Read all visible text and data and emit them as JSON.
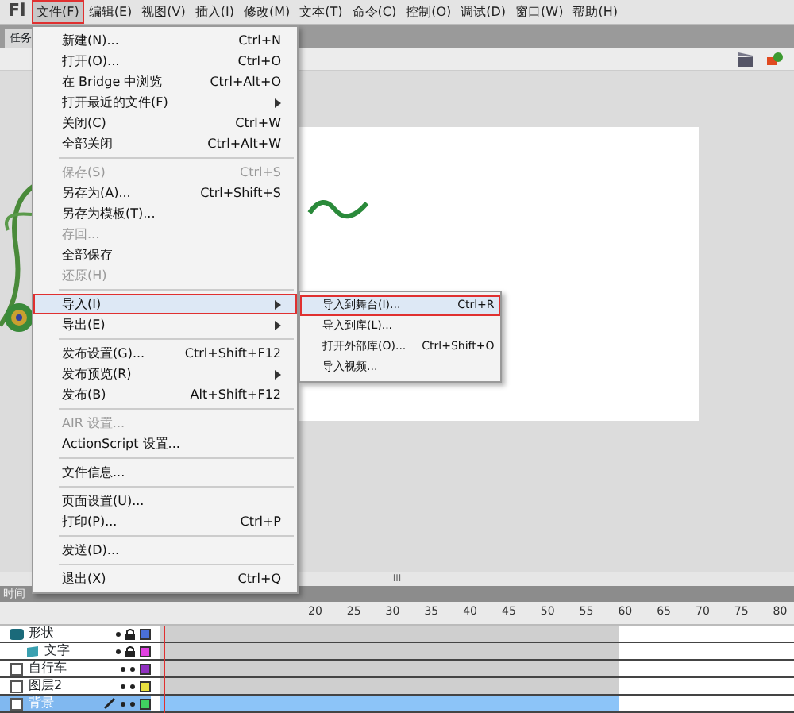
{
  "app": {
    "logo": "Fl"
  },
  "menu_bar": [
    {
      "label": "文件(F)",
      "selected": true,
      "highlighted": true
    },
    {
      "label": "编辑(E)",
      "selected": false,
      "highlighted": false
    },
    {
      "label": "视图(V)",
      "selected": false,
      "highlighted": false
    },
    {
      "label": "插入(I)",
      "selected": false,
      "highlighted": false
    },
    {
      "label": "修改(M)",
      "selected": false,
      "highlighted": false
    },
    {
      "label": "文本(T)",
      "selected": false,
      "highlighted": false
    },
    {
      "label": "命令(C)",
      "selected": false,
      "highlighted": false
    },
    {
      "label": "控制(O)",
      "selected": false,
      "highlighted": false
    },
    {
      "label": "调试(D)",
      "selected": false,
      "highlighted": false
    },
    {
      "label": "窗口(W)",
      "selected": false,
      "highlighted": false
    },
    {
      "label": "帮助(H)",
      "selected": false,
      "highlighted": false
    }
  ],
  "document_tab": {
    "label": "任务"
  },
  "file_menu": [
    {
      "kind": "item",
      "label": "新建(N)...",
      "shortcut": "Ctrl+N",
      "disabled": false,
      "submenu": false,
      "selected": false,
      "highlighted": false
    },
    {
      "kind": "item",
      "label": "打开(O)...",
      "shortcut": "Ctrl+O",
      "disabled": false,
      "submenu": false,
      "selected": false,
      "highlighted": false
    },
    {
      "kind": "item",
      "label": "在 Bridge 中浏览",
      "shortcut": "Ctrl+Alt+O",
      "disabled": false,
      "submenu": false,
      "selected": false,
      "highlighted": false
    },
    {
      "kind": "item",
      "label": "打开最近的文件(F)",
      "disabled": false,
      "submenu": true,
      "selected": false,
      "highlighted": false
    },
    {
      "kind": "item",
      "label": "关闭(C)",
      "shortcut": "Ctrl+W",
      "disabled": false,
      "submenu": false,
      "selected": false,
      "highlighted": false
    },
    {
      "kind": "item",
      "label": "全部关闭",
      "shortcut": "Ctrl+Alt+W",
      "disabled": false,
      "submenu": false,
      "selected": false,
      "highlighted": false
    },
    {
      "kind": "separator"
    },
    {
      "kind": "item",
      "label": "保存(S)",
      "shortcut": "Ctrl+S",
      "disabled": true,
      "submenu": false,
      "selected": false,
      "highlighted": false
    },
    {
      "kind": "item",
      "label": "另存为(A)...",
      "shortcut": "Ctrl+Shift+S",
      "disabled": false,
      "submenu": false,
      "selected": false,
      "highlighted": false
    },
    {
      "kind": "item",
      "label": "另存为模板(T)...",
      "disabled": false,
      "submenu": false,
      "selected": false,
      "highlighted": false
    },
    {
      "kind": "item",
      "label": "存回...",
      "disabled": true,
      "submenu": false,
      "selected": false,
      "highlighted": false
    },
    {
      "kind": "item",
      "label": "全部保存",
      "disabled": false,
      "submenu": false,
      "selected": false,
      "highlighted": false
    },
    {
      "kind": "item",
      "label": "还原(H)",
      "disabled": true,
      "submenu": false,
      "selected": false,
      "highlighted": false
    },
    {
      "kind": "separator"
    },
    {
      "kind": "item",
      "label": "导入(I)",
      "disabled": false,
      "submenu": true,
      "selected": true,
      "highlighted": true
    },
    {
      "kind": "item",
      "label": "导出(E)",
      "disabled": false,
      "submenu": true,
      "selected": false,
      "highlighted": false
    },
    {
      "kind": "separator"
    },
    {
      "kind": "item",
      "label": "发布设置(G)...",
      "shortcut": "Ctrl+Shift+F12",
      "disabled": false,
      "submenu": false,
      "selected": false,
      "highlighted": false
    },
    {
      "kind": "item",
      "label": "发布预览(R)",
      "disabled": false,
      "submenu": true,
      "selected": false,
      "highlighted": false
    },
    {
      "kind": "item",
      "label": "发布(B)",
      "shortcut": "Alt+Shift+F12",
      "disabled": false,
      "submenu": false,
      "selected": false,
      "highlighted": false
    },
    {
      "kind": "separator"
    },
    {
      "kind": "item",
      "label": "AIR 设置...",
      "disabled": true,
      "submenu": false,
      "selected": false,
      "highlighted": false
    },
    {
      "kind": "item",
      "label": "ActionScript 设置...",
      "disabled": false,
      "submenu": false,
      "selected": false,
      "highlighted": false
    },
    {
      "kind": "separator"
    },
    {
      "kind": "item",
      "label": "文件信息...",
      "disabled": false,
      "submenu": false,
      "selected": false,
      "highlighted": false
    },
    {
      "kind": "separator"
    },
    {
      "kind": "item",
      "label": "页面设置(U)...",
      "disabled": false,
      "submenu": false,
      "selected": false,
      "highlighted": false
    },
    {
      "kind": "item",
      "label": "打印(P)...",
      "shortcut": "Ctrl+P",
      "disabled": false,
      "submenu": false,
      "selected": false,
      "highlighted": false
    },
    {
      "kind": "separator"
    },
    {
      "kind": "item",
      "label": "发送(D)...",
      "disabled": false,
      "submenu": false,
      "selected": false,
      "highlighted": false
    },
    {
      "kind": "separator"
    },
    {
      "kind": "item",
      "label": "退出(X)",
      "shortcut": "Ctrl+Q",
      "disabled": false,
      "submenu": false,
      "selected": false,
      "highlighted": false
    }
  ],
  "import_submenu": [
    {
      "label": "导入到舞台(I)...",
      "shortcut": "Ctrl+R",
      "selected": true,
      "highlighted": true
    },
    {
      "label": "导入到库(L)...",
      "selected": false,
      "highlighted": false
    },
    {
      "label": "打开外部库(O)...",
      "shortcut": "Ctrl+Shift+O",
      "selected": false,
      "highlighted": false
    },
    {
      "label": "导入视频...",
      "selected": false,
      "highlighted": false
    }
  ],
  "scrollbar": {
    "grip": "III"
  },
  "timeline": {
    "title": "时间",
    "ruler": [
      "20",
      "25",
      "30",
      "35",
      "40",
      "45",
      "50",
      "55",
      "60",
      "65",
      "70",
      "75",
      "80"
    ],
    "layers": [
      {
        "name": "形状",
        "kind": "mask",
        "locked": true,
        "selected": false,
        "color": "#4a6fd8",
        "children": [
          {
            "name": "文字",
            "kind": "masked",
            "locked": true,
            "selected": false,
            "color": "#e040e0"
          }
        ]
      },
      {
        "name": "自行车",
        "kind": "normal",
        "locked": false,
        "selected": false,
        "color": "#9030c0"
      },
      {
        "name": "图层2",
        "kind": "normal",
        "locked": false,
        "selected": false,
        "color": "#e8e040"
      },
      {
        "name": "背景",
        "kind": "normal",
        "locked": false,
        "selected": true,
        "color": "#40d060"
      }
    ]
  }
}
